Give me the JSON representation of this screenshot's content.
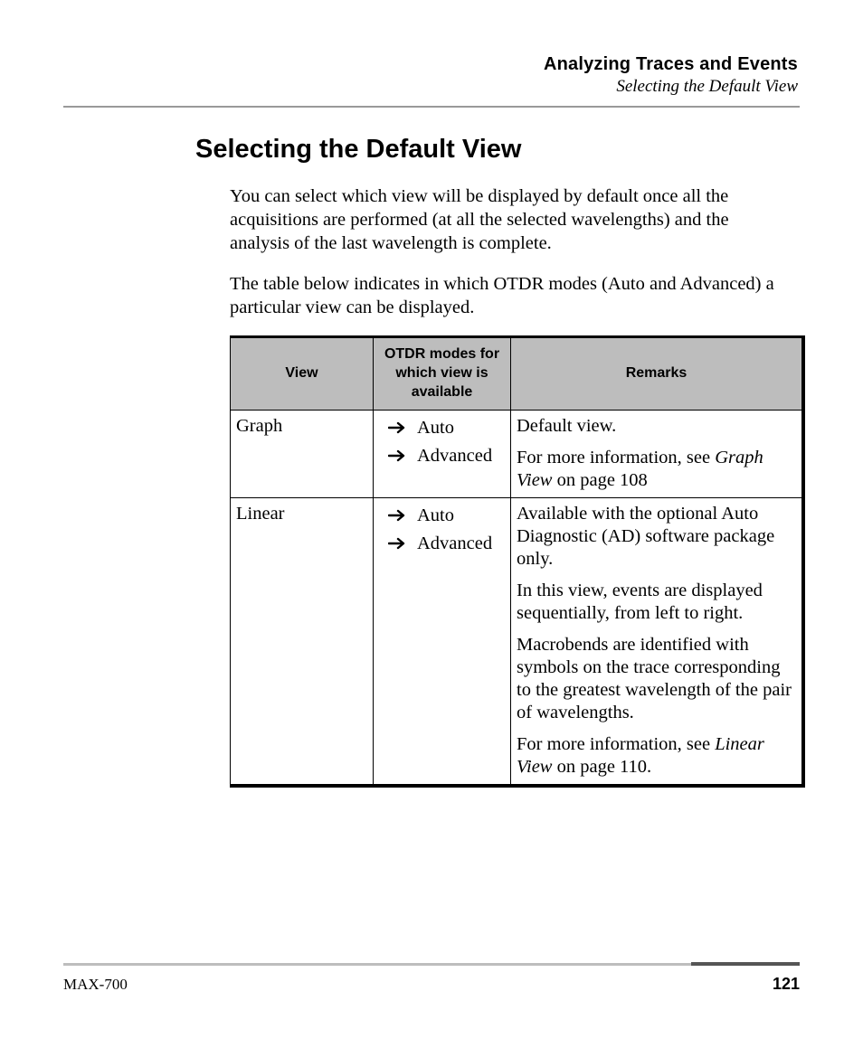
{
  "running_head": {
    "chapter": "Analyzing Traces and Events",
    "section": "Selecting the Default View"
  },
  "heading": "Selecting the Default View",
  "paragraphs": {
    "p1": "You can select which view will be displayed by default once all the acquisitions are performed (at all the selected wavelengths) and the analysis of the last wavelength is complete.",
    "p2": "The table below indicates in which OTDR modes (Auto and Advanced) a particular view can be displayed."
  },
  "table": {
    "headers": {
      "c1": "View",
      "c2": "OTDR modes for which view is available",
      "c3": "Remarks"
    },
    "rows": [
      {
        "view": "Graph",
        "modes": [
          "Auto",
          "Advanced"
        ],
        "remarks": {
          "r1a": "Default view.",
          "r1b_pre": "For more information, see ",
          "r1b_ital": "Graph View",
          "r1b_post": " on page 108"
        }
      },
      {
        "view": "Linear",
        "modes": [
          "Auto",
          "Advanced"
        ],
        "remarks": {
          "r2a": "Available with the optional Auto Diagnostic (AD) software package only.",
          "r2b": "In this view, events are displayed sequentially, from left to right.",
          "r2c": "Macrobends are identified with symbols on the trace corresponding to the greatest wavelength of the pair of wavelengths.",
          "r2d_pre": "For more information, see ",
          "r2d_ital": "Linear View",
          "r2d_post": " on page 110."
        }
      }
    ]
  },
  "footer": {
    "model": "MAX-700",
    "page": "121"
  }
}
